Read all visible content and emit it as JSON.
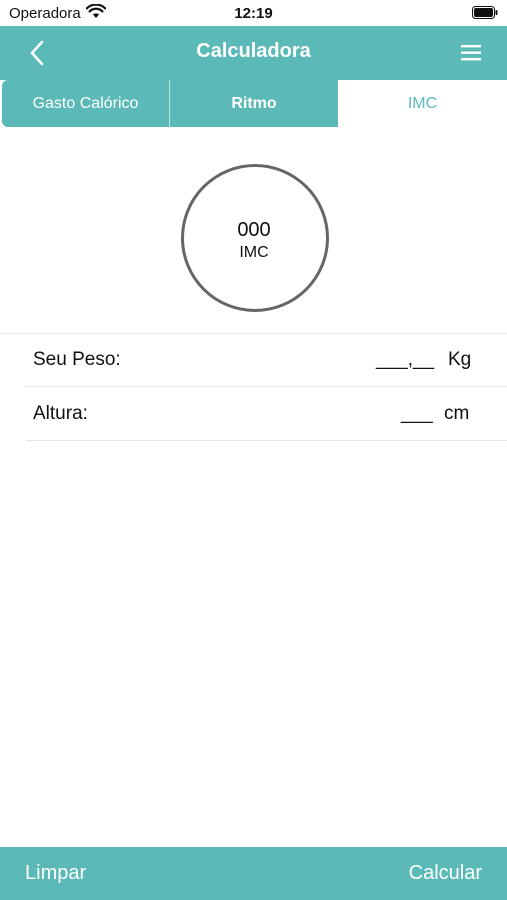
{
  "status_bar": {
    "carrier": "Operadora",
    "time": "12:19"
  },
  "navbar": {
    "title": "Calculadora"
  },
  "tabs": [
    {
      "label": "Gasto Calórico",
      "selected": false
    },
    {
      "label": "Ritmo",
      "selected": false
    },
    {
      "label": "IMC",
      "selected": true
    }
  ],
  "result": {
    "value": "000",
    "label": "IMC"
  },
  "form": {
    "weight": {
      "label": "Seu Peso:",
      "value": "___,__",
      "unit": "Kg"
    },
    "height": {
      "label": "Altura:",
      "value": "___",
      "unit": "cm"
    }
  },
  "actions": {
    "clear_label": "Limpar",
    "calculate_label": "Calcular"
  },
  "colors": {
    "accent": "#5bbab8",
    "text": "#111111",
    "gauge_ring": "#666666"
  }
}
